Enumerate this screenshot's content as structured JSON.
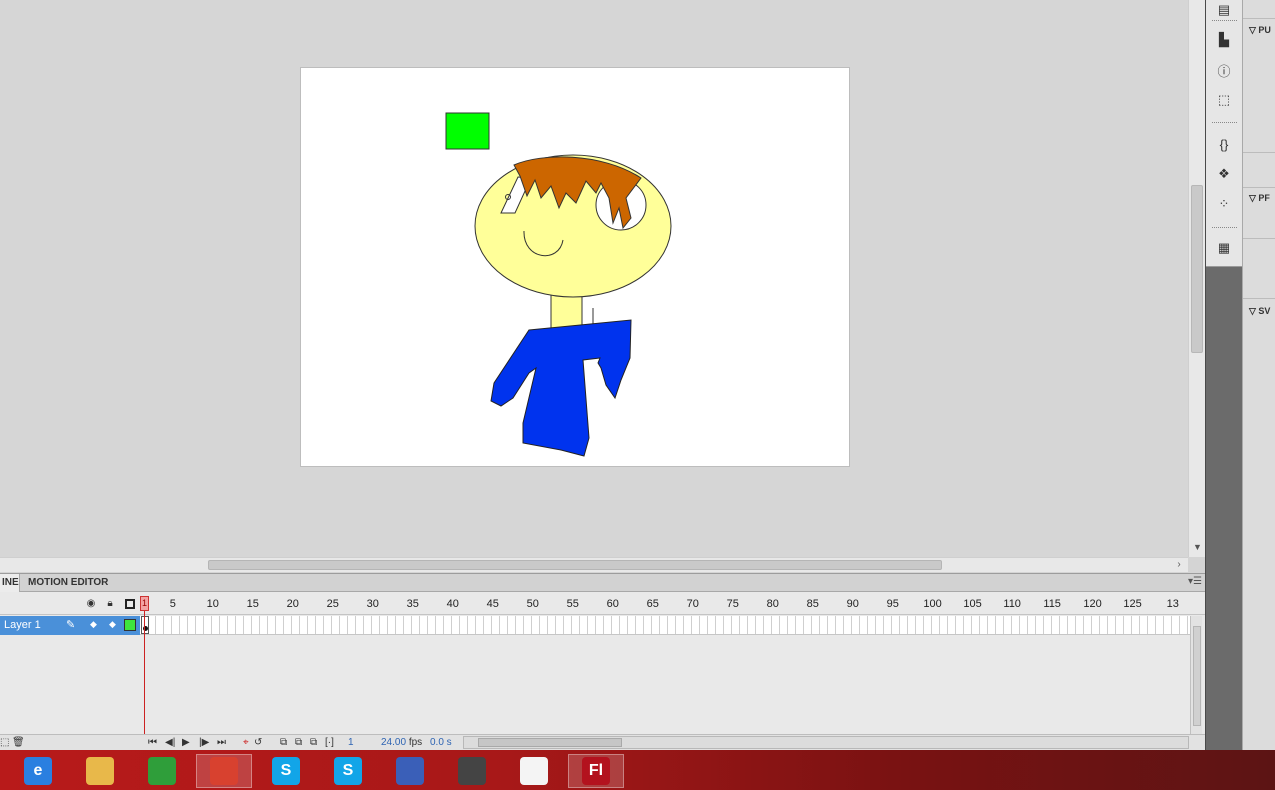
{
  "timeline": {
    "tabs": {
      "timeline": "INE",
      "motion_editor": "MOTION EDITOR"
    },
    "frame_numbers": [
      "1",
      "5",
      "10",
      "15",
      "20",
      "25",
      "30",
      "35",
      "40",
      "45",
      "50",
      "55",
      "60",
      "65",
      "70",
      "75",
      "80",
      "85",
      "90",
      "95",
      "100",
      "105",
      "110",
      "115",
      "120",
      "125",
      "13"
    ],
    "layers": [
      {
        "name": "Layer 1",
        "color": "#3ee63e"
      }
    ],
    "status": {
      "current_frame": "1",
      "frame_rate": "24.00",
      "frame_rate_unit": "fps",
      "elapsed": "0.0 s"
    }
  },
  "panels": {
    "headers": [
      "PU",
      "PF",
      "SV"
    ]
  },
  "taskbar": {
    "apps": [
      {
        "name": "internet-explorer",
        "label": "e",
        "color": "#2a7fe0"
      },
      {
        "name": "file-explorer",
        "label": "",
        "color": "#e8b84a"
      },
      {
        "name": "windows-store",
        "label": "",
        "color": "#2f9e3a"
      },
      {
        "name": "chrome",
        "label": "",
        "color": "#d8412f"
      },
      {
        "name": "skype",
        "label": "S",
        "color": "#12a5e8"
      },
      {
        "name": "skype-2",
        "label": "S",
        "color": "#12a5e8"
      },
      {
        "name": "paint-tool",
        "label": "",
        "color": "#3a5fb8"
      },
      {
        "name": "movie-maker",
        "label": "",
        "color": "#444444"
      },
      {
        "name": "document",
        "label": "",
        "color": "#f4f4f4"
      },
      {
        "name": "flash",
        "label": "Fl",
        "color": "#b3121e"
      }
    ]
  },
  "colors": {
    "stage_bg": "#ffffff",
    "face": "#ffff99",
    "hair": "#cc6600",
    "shirt": "#0033ee",
    "square": "#00ff00",
    "selected_layer": "#4a90d9"
  }
}
